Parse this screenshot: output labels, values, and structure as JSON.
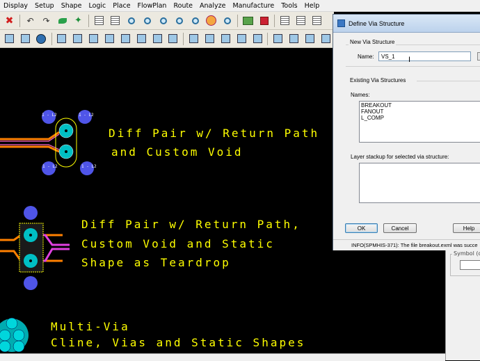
{
  "menu": [
    "Display",
    "Setup",
    "Shape",
    "Logic",
    "Place",
    "FlowPlan",
    "Route",
    "Analyze",
    "Manufacture",
    "Tools",
    "Help"
  ],
  "toolbar1": [
    "close-icon",
    "undo-icon",
    "redo-icon",
    "net-icon",
    "pin-icon",
    "grid-icon",
    "grid-icon",
    "zoom-icon",
    "zoom-icon",
    "zoom-icon",
    "zoom-icon",
    "zoom-icon",
    "refresh-icon",
    "zoom-icon",
    "flow-icon",
    "3d-icon",
    "grid-icon",
    "grid-icon",
    "grid-icon"
  ],
  "toolbar2": [
    "shape-icon",
    "shape-icon",
    "circle-icon",
    "box-icon",
    "box-icon",
    "box-icon",
    "box-icon",
    "box-icon",
    "box-icon",
    "box-icon",
    "box-icon",
    "align-icon",
    "align-icon",
    "align-icon",
    "align-icon",
    "align-icon",
    "component-icon",
    "component-icon",
    "component-icon",
    "component-icon"
  ],
  "canvas": {
    "bg": "#000000",
    "text_color": "#ffff00",
    "via_labels": [
      "1 - L2",
      "1 - L2",
      "1 - L2",
      "1 - L2"
    ],
    "block1": [
      "Diff Pair w/ Return Path",
      "and Custom Void"
    ],
    "block2": [
      "Diff Pair w/ Return Path,",
      "Custom Void and Static",
      "Shape as Teardrop"
    ],
    "block3": [
      "Multi-Via",
      "Cline, Vias and Static Shapes"
    ]
  },
  "dialog": {
    "title": "Define Via Structure",
    "new_group_label": "New Via Structure",
    "name_label": "Name:",
    "name_value": "VS_1",
    "existing_group_label": "Existing Via Structures",
    "names_label": "Names:",
    "names": [
      "BREAKOUT",
      "FANOUT",
      "L_COMP"
    ],
    "stackup_label": "Layer stackup for selected via structure:",
    "ok_label": "OK",
    "cancel_label": "Cancel",
    "help_label": "Help",
    "status": "INFO(SPMHIS-371): The file breakout.exml was succe"
  },
  "side_panel": {
    "label": "Symbol (or"
  }
}
